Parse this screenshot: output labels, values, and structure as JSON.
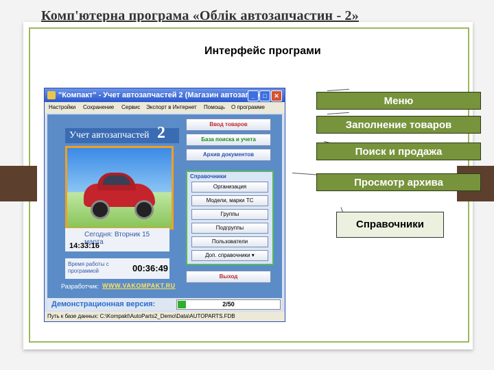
{
  "slide_title": "Комп'ютерна програма «Облік автозапчастин - 2»",
  "subtitle": "Интерфейс програми",
  "app": {
    "window_title": "\"Компакт\" - Учет автозапчастей 2 (Магазин автозапчас...",
    "window_buttons": [
      "_",
      "□",
      "✕"
    ],
    "menu": [
      "Настройки",
      "Сохранение",
      "Сервис",
      "Экспорт в Интернет",
      "Помощь",
      "О программе"
    ],
    "logo_text": "Учет автозапчастей",
    "logo_number": "2",
    "date_text": "Сегодня: Вторник 15 марта",
    "clock": "14:33:16",
    "work_time_label": "Время работы с программой",
    "work_time": "00:36:49",
    "developer_label": "Разработчик:",
    "developer_url": "WWW.VAKOMPAKT.RU",
    "buttons": {
      "input": "Ввод товаров",
      "search": "База поиска и учета",
      "archive": "Архив документов",
      "exit": "Выход"
    },
    "refs_header": "Справочники",
    "refs": [
      "Организация",
      "Модели, марки ТС",
      "Группы",
      "Подгруппы",
      "Пользователи",
      "Доп. справочники ▾"
    ],
    "demo_label": "Демонстрационная версия:",
    "demo_counter": "2/50",
    "demo_progress": 0.04,
    "status_path": "Путь к базе данных: C:\\Kompakt\\AutoParts2_Demo\\Data\\AUTOPARTS.FDB"
  },
  "callouts": {
    "menu": "Меню",
    "fill": "Заполнение товаров",
    "search": "Поиск и продажа",
    "archive": "Просмотр архива",
    "refs": "Справочники"
  },
  "colors": {
    "callout_green": "#77933c",
    "callout_light": "#ebf1de",
    "accent_brown": "#5d3f2e"
  }
}
